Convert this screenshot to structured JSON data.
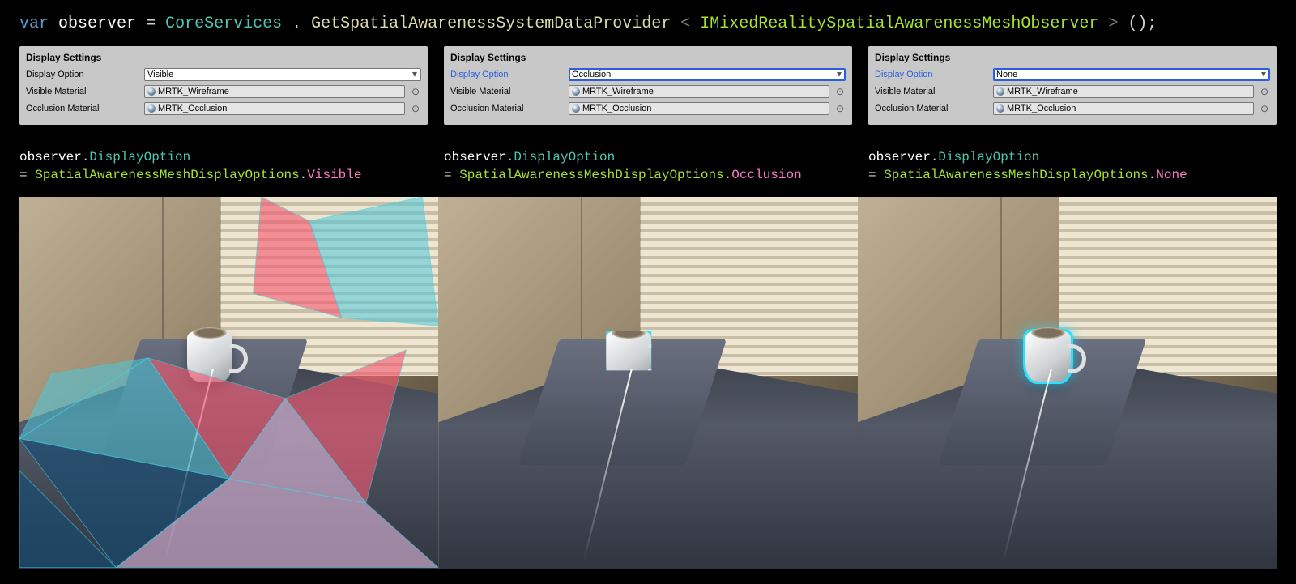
{
  "top_code": {
    "kw": "var",
    "var": "observer",
    "eq": " = ",
    "cls": "CoreServices",
    "dot1": ".",
    "method": "GetSpatialAwarenessSystemDataProvider",
    "lt": "<",
    "iface": "IMixedRealitySpatialAwarenessMeshObserver",
    "gt": ">",
    "paren": "();"
  },
  "panels": [
    {
      "title": "Display Settings",
      "option_highlight": false,
      "option_label": "Display Option",
      "option_value": "Visible",
      "vis_label": "Visible Material",
      "vis_value": "MRTK_Wireframe",
      "occ_label": "Occlusion Material",
      "occ_value": "MRTK_Occlusion"
    },
    {
      "title": "Display Settings",
      "option_highlight": true,
      "option_label": "Display Option",
      "option_value": "Occlusion",
      "vis_label": "Visible Material",
      "vis_value": "MRTK_Wireframe",
      "occ_label": "Occlusion Material",
      "occ_value": "MRTK_Occlusion"
    },
    {
      "title": "Display Settings",
      "option_highlight": true,
      "option_label": "Display Option",
      "option_value": "None",
      "vis_label": "Visible Material",
      "vis_value": "MRTK_Wireframe",
      "occ_label": "Occlusion Material",
      "occ_value": "MRTK_Occlusion"
    }
  ],
  "code_lines": [
    {
      "obj": "observer",
      "dot": ".",
      "prop": "DisplayOption",
      "eq": "= ",
      "enum": "SpatialAwarenessMeshDisplayOptions",
      "dot2": ".",
      "val": "Visible"
    },
    {
      "obj": "observer",
      "dot": ".",
      "prop": "DisplayOption",
      "eq": "= ",
      "enum": "SpatialAwarenessMeshDisplayOptions",
      "dot2": ".",
      "val": "Occlusion"
    },
    {
      "obj": "observer",
      "dot": ".",
      "prop": "DisplayOption",
      "eq": "= ",
      "enum": "SpatialAwarenessMeshDisplayOptions",
      "dot2": ".",
      "val": "None"
    }
  ],
  "odot": "⊙"
}
